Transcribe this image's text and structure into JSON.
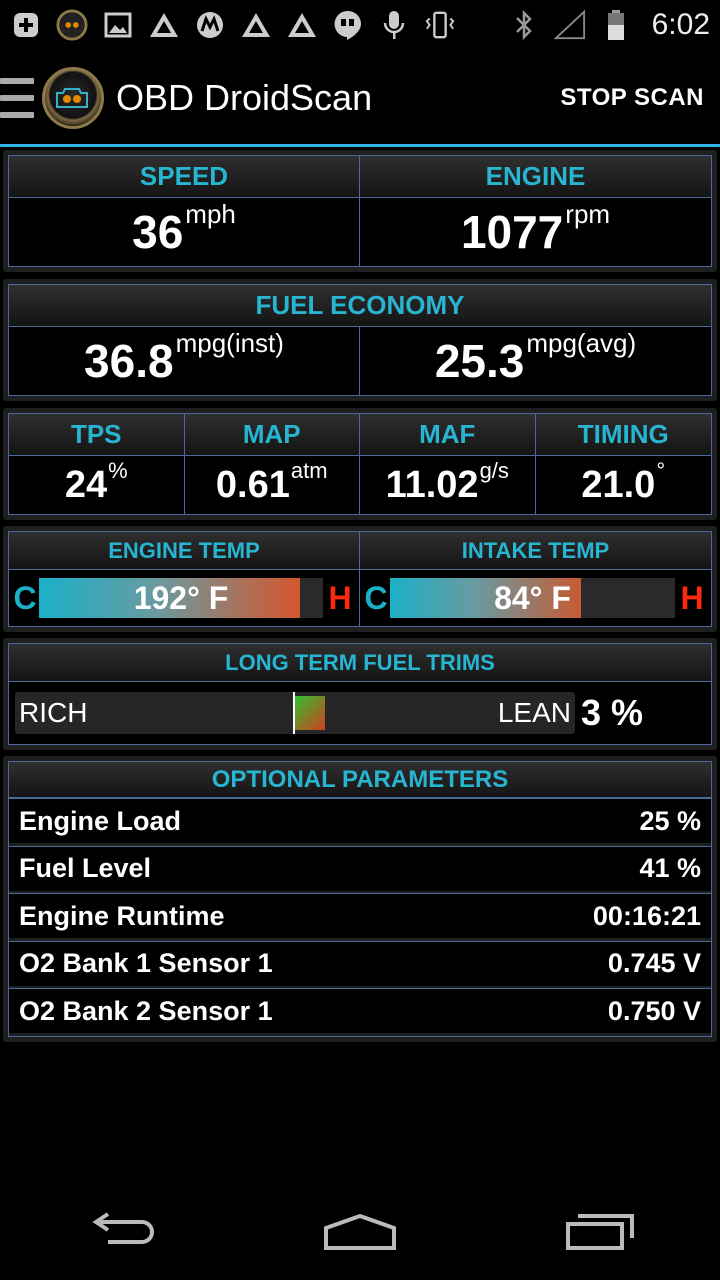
{
  "status_bar": {
    "time": "6:02",
    "icons": [
      "add-icon",
      "app-badge-icon",
      "image-icon",
      "triangle-logo-icon",
      "motorola-icon",
      "triangle-logo-icon",
      "triangle-logo-icon",
      "hangouts-icon",
      "mic-icon",
      "vibrate-icon",
      "bluetooth-icon",
      "signal-icon",
      "battery-icon"
    ]
  },
  "action_bar": {
    "title": "OBD DroidScan",
    "action": "STOP SCAN"
  },
  "speed_engine": {
    "speed_label": "SPEED",
    "speed_value": "36",
    "speed_unit": "mph",
    "engine_label": "ENGINE",
    "engine_value": "1077",
    "engine_unit": "rpm"
  },
  "fuel_economy": {
    "label": "FUEL ECONOMY",
    "inst_value": "36.8",
    "inst_unit": "mpg(inst)",
    "avg_value": "25.3",
    "avg_unit": "mpg(avg)"
  },
  "sensors": [
    {
      "label": "TPS",
      "value": "24",
      "unit": "%"
    },
    {
      "label": "MAP",
      "value": "0.61",
      "unit": "atm"
    },
    {
      "label": "MAF",
      "value": "11.02",
      "unit": "g/s"
    },
    {
      "label": "TIMING",
      "value": "21.0",
      "unit": "°"
    }
  ],
  "temps": [
    {
      "label": "ENGINE TEMP",
      "value": "192° F",
      "cold": "C",
      "hot": "H",
      "level": 0.92,
      "hot_color": "#d4562c",
      "cold_color": "#1bb0c8"
    },
    {
      "label": "INTAKE TEMP",
      "value": "84° F",
      "cold": "C",
      "hot": "H",
      "level": 0.67,
      "hot_color": "#c75a33",
      "cold_color": "#1bb0c8"
    }
  ],
  "fuel_trims": {
    "label": "LONG TERM FUEL TRIMS",
    "rich": "RICH",
    "lean": "LEAN",
    "value": "3 %",
    "percent": 3
  },
  "optional": {
    "label": "OPTIONAL PARAMETERS",
    "rows": [
      {
        "name": "Engine Load",
        "value": "25 %"
      },
      {
        "name": "Fuel Level",
        "value": "41 %"
      },
      {
        "name": "Engine Runtime",
        "value": "00:16:21"
      },
      {
        "name": "O2 Bank 1 Sensor 1",
        "value": "0.745 V"
      },
      {
        "name": "O2 Bank 2 Sensor 1",
        "value": "0.750 V"
      }
    ]
  },
  "colors": {
    "accent": "#27b5d2",
    "action_bar_line": "#33b5e5",
    "hot": "#ff2a0a",
    "border": "#4a6a9a"
  }
}
